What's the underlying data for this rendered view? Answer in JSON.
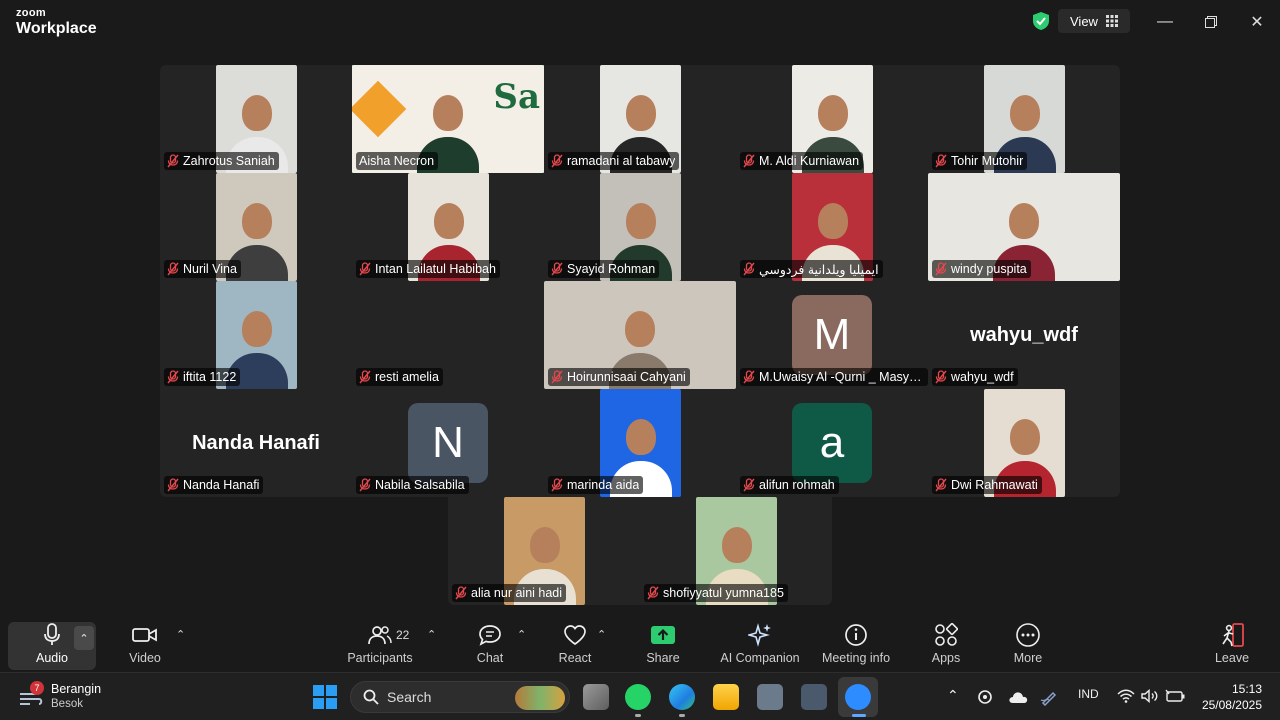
{
  "window": {
    "brand_top": "zoom",
    "brand_bottom": "Workplace",
    "view_label": "View",
    "shield_color": "#2ecc71"
  },
  "participants": [
    {
      "name": "Zahrotus Saniah",
      "col": 0,
      "row": 0,
      "kind": "video",
      "bg": "#dcdcd8",
      "shirt": "#e9e9e9",
      "muted": true
    },
    {
      "name": "Aisha Necron",
      "col": 1,
      "row": 0,
      "kind": "video-wide",
      "bg": "#f3efe6",
      "shirt": "#1f3d2d",
      "muted": false,
      "active": true,
      "sign_text": "Sa"
    },
    {
      "name": "ramadani al tabawy",
      "col": 2,
      "row": 0,
      "kind": "video",
      "bg": "#e6e6e3",
      "shirt": "#262626",
      "muted": true
    },
    {
      "name": "M. Aldi Kurniawan",
      "col": 3,
      "row": 0,
      "kind": "video",
      "bg": "#ecebe6",
      "shirt": "#3a4a3e",
      "muted": true
    },
    {
      "name": "Tohir Mutohir",
      "col": 4,
      "row": 0,
      "kind": "video",
      "bg": "#d7d9d6",
      "shirt": "#2b3a52",
      "muted": true
    },
    {
      "name": "Nuril Vina",
      "col": 0,
      "row": 1,
      "kind": "video",
      "bg": "#cfc9bd",
      "shirt": "#3e3e3e",
      "muted": true
    },
    {
      "name": "Intan Lailatul Habibah",
      "col": 1,
      "row": 1,
      "kind": "video",
      "bg": "#e8e3da",
      "shirt": "#a8252f",
      "muted": true
    },
    {
      "name": "Syayid Rohman",
      "col": 2,
      "row": 1,
      "kind": "video",
      "bg": "#c2c0b8",
      "shirt": "#223a2b",
      "muted": true
    },
    {
      "name": "ايميليا ويلدانية فردوسي",
      "col": 3,
      "row": 1,
      "kind": "video",
      "bg": "#b92f3a",
      "shirt": "#e9e3d6",
      "muted": true
    },
    {
      "name": "windy puspita",
      "col": 4,
      "row": 1,
      "kind": "video-wide",
      "bg": "#e8e6e0",
      "shirt": "#8a2434",
      "muted": true
    },
    {
      "name": "iftita 1122",
      "col": 0,
      "row": 2,
      "kind": "video",
      "bg": "#9fb7c3",
      "shirt": "#2c3e5c",
      "muted": true
    },
    {
      "name": "resti amelia",
      "col": 1,
      "row": 2,
      "kind": "blank",
      "muted": true
    },
    {
      "name": "Hoirunnisaai Cahyani",
      "col": 2,
      "row": 2,
      "kind": "video-wide",
      "bg": "#cdc6bd",
      "shirt": "#8a7a6c",
      "muted": true
    },
    {
      "name": "M.Uwaisy Al -Qurni _ Masya...",
      "col": 3,
      "row": 2,
      "kind": "letter",
      "letter": "M",
      "avatar_bg": "#8a6a5e",
      "muted": true
    },
    {
      "name": "wahyu_wdf",
      "col": 4,
      "row": 2,
      "kind": "name",
      "display": "wahyu_wdf",
      "muted": true
    },
    {
      "name": "Nanda Hanafi",
      "col": 0,
      "row": 3,
      "kind": "name",
      "display": "Nanda Hanafi",
      "muted": true
    },
    {
      "name": "Nabila Salsabila",
      "col": 1,
      "row": 3,
      "kind": "letter",
      "letter": "N",
      "avatar_bg": "#4a5564",
      "muted": true
    },
    {
      "name": "marinda aida",
      "col": 2,
      "row": 3,
      "kind": "video",
      "bg": "#1f66e5",
      "shirt": "#ffffff",
      "muted": true
    },
    {
      "name": "alifun rohmah",
      "col": 3,
      "row": 3,
      "kind": "letter",
      "letter": "a",
      "avatar_bg": "#0f5a47",
      "muted": true
    },
    {
      "name": "Dwi Rahmawati",
      "col": 4,
      "row": 3,
      "kind": "video",
      "bg": "#e5ddd2",
      "shirt": "#b4252f",
      "muted": true
    },
    {
      "name": "alia nur aini hadi",
      "col": 0,
      "row": 4,
      "kind": "video",
      "bg": "#c79a66",
      "shirt": "#e7e0d3",
      "muted": true
    },
    {
      "name": "shofiyyatul yumna185",
      "col": 1,
      "row": 4,
      "kind": "video",
      "bg": "#a9c8a0",
      "shirt": "#e8dcc3",
      "muted": true
    }
  ],
  "toolbar": {
    "audio": "Audio",
    "video": "Video",
    "participants": "Participants",
    "participants_count": "22",
    "chat": "Chat",
    "react": "React",
    "share": "Share",
    "ai_companion": "AI Companion",
    "meeting_info": "Meeting info",
    "apps": "Apps",
    "more": "More",
    "leave": "Leave",
    "share_color": "#2ecc71",
    "leave_color": "#e5484d"
  },
  "taskbar": {
    "weather_title": "Berangin",
    "weather_sub": "Besok",
    "weather_badge": "7",
    "search_placeholder": "Search",
    "language": "IND",
    "time": "15:13",
    "date": "25/08/2025"
  }
}
